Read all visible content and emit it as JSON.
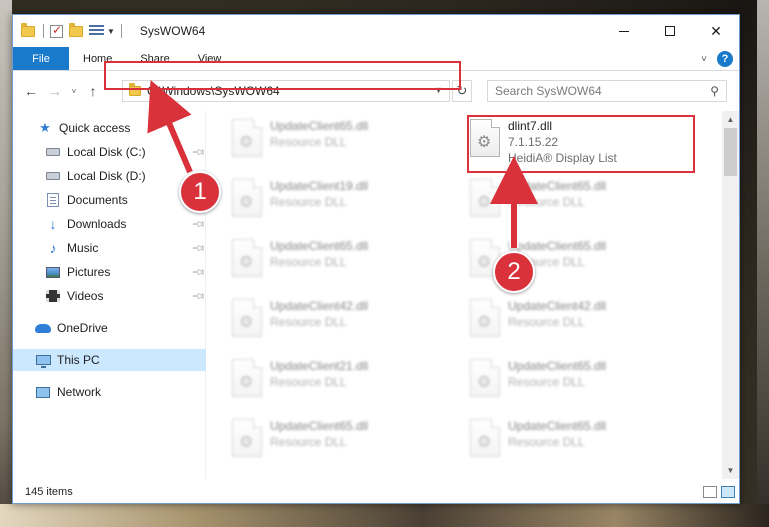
{
  "window": {
    "title": "SysWOW64",
    "minimize_label": "—",
    "close_label": "✕"
  },
  "ribbon": {
    "file_tab": "File",
    "tabs": [
      "Home",
      "Share",
      "View"
    ],
    "help_label": "?"
  },
  "nav": {
    "back": "←",
    "forward": "→",
    "recent": "˅",
    "up": "↑",
    "address": "C:\\Windows\\SysWOW64",
    "search_placeholder": "Search SysWOW64"
  },
  "sidebar": {
    "items": [
      {
        "label": "Quick access",
        "icon": "star-icon",
        "pinned": false
      },
      {
        "label": "Local Disk (C:)",
        "icon": "drive-icon",
        "pinned": true
      },
      {
        "label": "Local Disk (D:)",
        "icon": "drive-icon",
        "pinned": false
      },
      {
        "label": "Documents",
        "icon": "documents-icon",
        "pinned": true
      },
      {
        "label": "Downloads",
        "icon": "downloads-icon",
        "pinned": true
      },
      {
        "label": "Music",
        "icon": "music-icon",
        "pinned": true
      },
      {
        "label": "Pictures",
        "icon": "pictures-icon",
        "pinned": true
      },
      {
        "label": "Videos",
        "icon": "videos-icon",
        "pinned": true
      },
      {
        "label": "OneDrive",
        "icon": "onedrive-icon",
        "pinned": false
      },
      {
        "label": "This PC",
        "icon": "this-pc-icon",
        "pinned": false,
        "selected": true
      },
      {
        "label": "Network",
        "icon": "network-icon",
        "pinned": false
      }
    ]
  },
  "files": {
    "left_column": [
      {
        "name": "UpdateClient65.dll",
        "type": "Resource DLL"
      },
      {
        "name": "UpdateClient19.dll",
        "type": "Resource DLL"
      },
      {
        "name": "UpdateClient65.dll",
        "type": "Resource DLL"
      },
      {
        "name": "UpdateClient42.dll",
        "type": "Resource DLL"
      },
      {
        "name": "UpdateClient21.dll",
        "type": "Resource DLL"
      },
      {
        "name": "UpdateClient65.dll",
        "type": "Resource DLL"
      }
    ],
    "right_column": [
      {
        "name": "dlint7.dll",
        "type": "7.1.15.22",
        "extra": "HeidiA® Display List"
      },
      {
        "name": "UpdateClient65.dll",
        "type": "Resource DLL"
      },
      {
        "name": "UpdateClient65.dll",
        "type": "Resource DLL"
      },
      {
        "name": "UpdateClient42.dll",
        "type": "Resource DLL"
      },
      {
        "name": "UpdateClient65.dll",
        "type": "Resource DLL"
      },
      {
        "name": "UpdateClient65.dll",
        "type": "Resource DLL"
      }
    ]
  },
  "status": {
    "item_count": "145 items"
  },
  "annotations": {
    "step1": "1",
    "step2": "2",
    "highlight_color": "#d9323a"
  },
  "colors": {
    "accent": "#1979ca",
    "selection": "#cce8ff"
  }
}
